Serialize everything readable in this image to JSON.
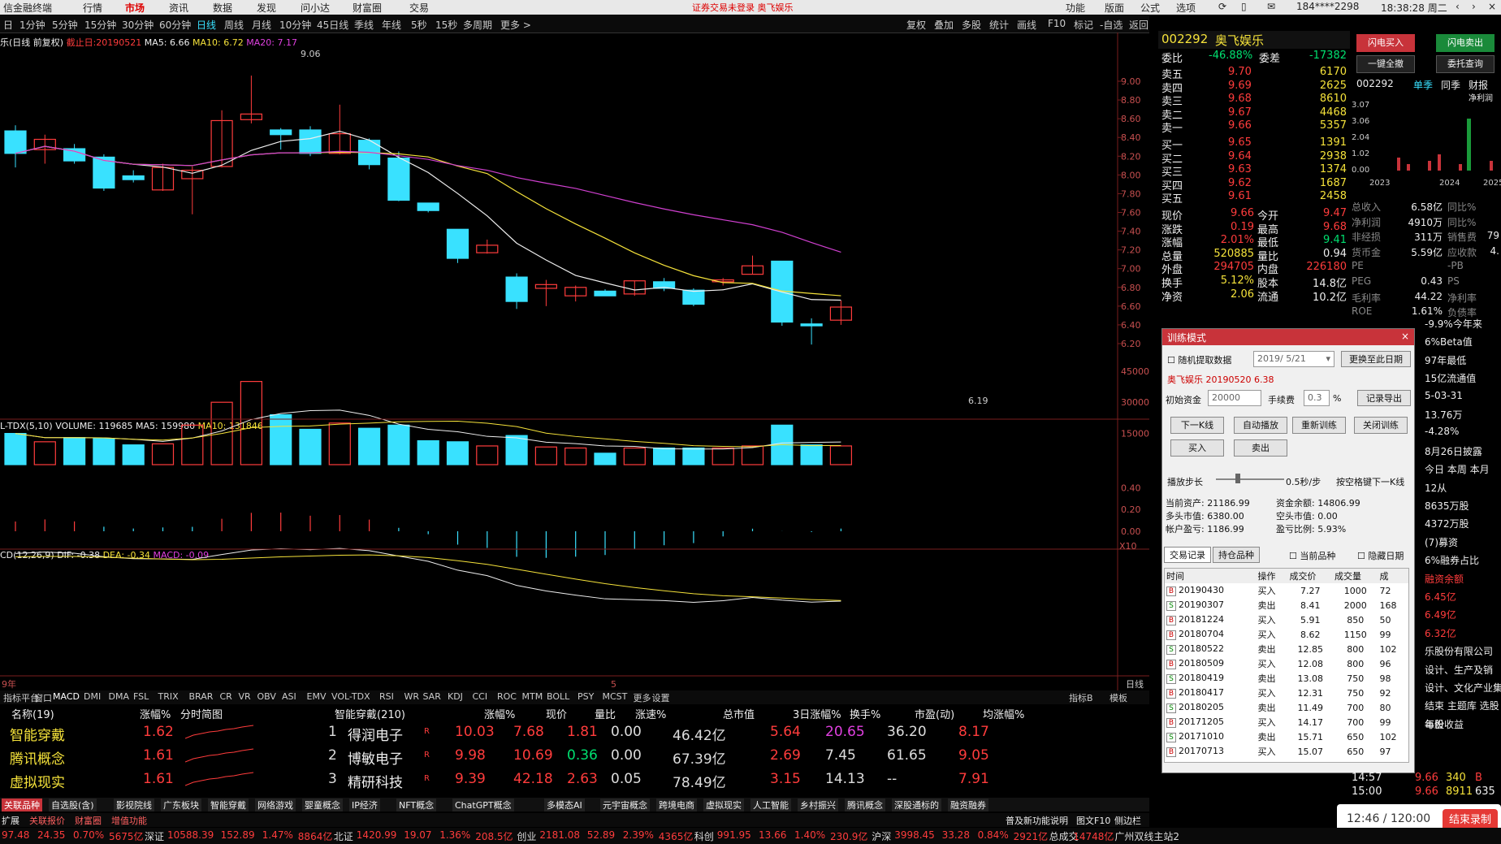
{
  "menu": {
    "items": [
      "信金融终端",
      "行情",
      "市场",
      "资讯",
      "数据",
      "发现",
      "问小达",
      "财富圈",
      "交易"
    ],
    "warning": "证券交易未登录  奥飞娱乐",
    "right": [
      "功能",
      "版面",
      "公式",
      "选项"
    ],
    "user": "184****2298",
    "time": "18:38:28 周二"
  },
  "periods": [
    "日",
    "1分钟",
    "5分钟",
    "15分钟",
    "30分钟",
    "60分钟",
    "日线",
    "周线",
    "月线",
    "10分钟",
    "45日线",
    "季线",
    "年线",
    "5秒",
    "15秒",
    "多周期",
    "更多 >"
  ],
  "toolbar_right": [
    "复权",
    "叠加",
    "多股",
    "统计",
    "画线",
    "F10",
    "标记",
    "-自选",
    "返回"
  ],
  "chart_info": {
    "title": "乐(日线 前复权)",
    "stop": "截止日:20190521",
    "ma5": "MA5: 6.66",
    "ma10": "MA10: 6.72",
    "ma20": "MA20: 7.17"
  },
  "price_axis": [
    "9.00",
    "8.80",
    "8.60",
    "8.40",
    "8.20",
    "8.00",
    "7.80",
    "7.60",
    "7.40",
    "7.20",
    "7.00",
    "6.80",
    "6.60",
    "6.40",
    "6.20"
  ],
  "price_high": "9.06",
  "price_low": "6.19",
  "vol_info": {
    "label": "L-TDX(5,10)  VOLUME: 119685",
    "ma5": "MA5: 159980",
    "ma10": "MA10: 131846"
  },
  "vol_axis": [
    "45000",
    "30000",
    "15000"
  ],
  "vol_unit": "X10",
  "macd_info": {
    "label": "CD(12,26,9)  DIF: -0.38",
    "dea": "DEA: -0.34",
    "macd": "MACD: -0.09"
  },
  "macd_axis": [
    "0.40",
    "0.20",
    "0.00"
  ],
  "x_axis": {
    "left": "9年",
    "mid": "5",
    "right": "日线"
  },
  "candles": [
    [
      8.47,
      8.23,
      8.53,
      8.08
    ],
    [
      8.27,
      8.38,
      8.43,
      8.12
    ],
    [
      8.28,
      8.15,
      8.33,
      8.12
    ],
    [
      8.19,
      7.86,
      8.22,
      7.83
    ],
    [
      7.99,
      7.95,
      8.05,
      7.92
    ],
    [
      7.84,
      8.08,
      8.12,
      7.83
    ],
    [
      7.96,
      8.05,
      8.09,
      7.58
    ],
    [
      8.09,
      8.58,
      8.69,
      8.08
    ],
    [
      8.59,
      8.65,
      9.06,
      8.55
    ],
    [
      8.48,
      8.43,
      8.5,
      8.27
    ],
    [
      8.48,
      8.23,
      8.52,
      8.2
    ],
    [
      8.23,
      8.44,
      8.75,
      8.22
    ],
    [
      8.37,
      8.11,
      8.39,
      8.06
    ],
    [
      8.18,
      7.73,
      8.25,
      7.72
    ],
    [
      7.7,
      7.62,
      7.7,
      7.6
    ],
    [
      7.42,
      7.11,
      7.42,
      7.06
    ],
    [
      7.17,
      7.25,
      7.31,
      7.16
    ],
    [
      6.91,
      6.65,
      6.95,
      6.57
    ],
    [
      6.79,
      6.83,
      6.88,
      6.6
    ],
    [
      6.71,
      6.8,
      6.82,
      6.65
    ],
    [
      6.76,
      6.71,
      6.78,
      6.71
    ],
    [
      6.73,
      6.87,
      6.87,
      6.71
    ],
    [
      6.86,
      6.79,
      6.9,
      6.76
    ],
    [
      6.77,
      6.62,
      6.79,
      6.6
    ],
    [
      6.86,
      6.88,
      6.9,
      6.82
    ],
    [
      6.94,
      7.03,
      7.14,
      6.94
    ],
    [
      7.08,
      6.43,
      7.08,
      6.39
    ],
    [
      6.41,
      6.39,
      6.47,
      6.19
    ],
    [
      6.45,
      6.59,
      6.66,
      6.4
    ]
  ],
  "volumes": [
    15000,
    11000,
    13000,
    12500,
    9500,
    10000,
    19000,
    30000,
    40000,
    24000,
    17000,
    20000,
    17500,
    19000,
    11500,
    11000,
    9000,
    14000,
    8500,
    8000,
    5500,
    8000,
    8000,
    8000,
    8000,
    9000,
    19000,
    9500,
    9000
  ],
  "orderbook": {
    "code": "002292",
    "name": "奥飞娱乐",
    "weibi": "-46.88%",
    "weicha": "-17382",
    "asks": [
      [
        "卖五",
        "9.70",
        "6170"
      ],
      [
        "卖四",
        "9.69",
        "2625"
      ],
      [
        "卖三",
        "9.68",
        "8610"
      ],
      [
        "卖二",
        "9.67",
        "4468"
      ],
      [
        "卖一",
        "9.66",
        "5357"
      ]
    ],
    "bids": [
      [
        "买一",
        "9.65",
        "1391"
      ],
      [
        "买二",
        "9.64",
        "2938"
      ],
      [
        "买三",
        "9.63",
        "1374"
      ],
      [
        "买四",
        "9.62",
        "1687"
      ],
      [
        "买五",
        "9.61",
        "2458"
      ]
    ],
    "stats": [
      [
        "现价",
        "9.66",
        "今开",
        "9.47"
      ],
      [
        "涨跌",
        "0.19",
        "最高",
        "9.68"
      ],
      [
        "涨幅",
        "2.01%",
        "最低",
        "9.41"
      ],
      [
        "总量",
        "520885",
        "量比",
        "0.94"
      ],
      [
        "外盘",
        "294705",
        "内盘",
        "226180"
      ],
      [
        "换手",
        "5.12%",
        "股本",
        "14.8亿"
      ],
      [
        "净资",
        "2.06",
        "流通",
        "10.2亿"
      ]
    ]
  },
  "right_panel": {
    "btn1": "闪电买入",
    "btn2": "闪电卖出",
    "btn3": "一键全撤",
    "btn4": "委托查询",
    "tabs": [
      "002292",
      "单季",
      "同季",
      "财报"
    ],
    "netlabel": "净利润",
    "years": [
      "2023",
      "2024",
      "2025"
    ],
    "yvals": [
      "3.07",
      "3.06",
      "2.04",
      "1.02",
      "0.00"
    ],
    "fin": [
      [
        "总收入",
        "6.58亿",
        "同比%"
      ],
      [
        "净利润",
        "4910万",
        "同比%"
      ],
      [
        "非经损",
        "311万",
        "销售费",
        "79"
      ],
      [
        "货币金",
        "5.59亿",
        "应收款",
        "4."
      ],
      [
        "PE",
        "",
        "-PB",
        ""
      ],
      [
        "PEG",
        "0.43",
        "PS",
        ""
      ],
      [
        "毛利率",
        "44.22",
        "净利率",
        ""
      ],
      [
        "ROE",
        "1.61%",
        "负债率",
        ""
      ]
    ],
    "extra": [
      "-9.9%今年来",
      "6%Beta值",
      "97年最低",
      "15亿流通值",
      "5-03-31",
      "13.76万",
      "-4.28%",
      "8月26日披露",
      "今日 本周 本月",
      "12从",
      "8635万股",
      "4372万股",
      "(7)募资",
      "6%融券占比",
      "融资余额",
      "6.45亿",
      "6.49亿",
      "6.32亿",
      "乐股份有限公司",
      "设计、生产及销",
      "设计、文化产业集团",
      "结束 主题库 选股",
      "年份",
      "每股收益"
    ]
  },
  "trainer": {
    "title": "训练模式",
    "random": "随机提取数据",
    "date": "2019/ 5/21",
    "change_date": "更换至此日期",
    "stock": "奥飞娱乐 20190520 6.38",
    "init_cap_label": "初始资金",
    "init_cap": "20000",
    "fee_label": "手续费",
    "fee": "0.3",
    "pct": "%",
    "export": "记录导出",
    "next": "下一K线",
    "auto": "自动播放",
    "retrain": "重新训练",
    "close": "关闭训练",
    "buy": "买入",
    "sell": "卖出",
    "step_label": "播放步长",
    "step": "0.5秒/步",
    "hint": "按空格键下一K线",
    "assets": "当前资产: 21186.99",
    "cash": "资金余额: 14806.99",
    "long": "多头市值: 6380.00",
    "short": "空头市值: 0.00",
    "profit": "帐户盈亏: 1186.99",
    "ratio": "盈亏比例: 5.93%",
    "tab1": "交易记录",
    "tab2": "持仓品种",
    "cur": "当前品种",
    "hide": "隐藏日期",
    "cols": [
      "时间",
      "操作",
      "成交价",
      "成交量",
      "成"
    ],
    "trades": [
      [
        "B",
        "20190430",
        "买入",
        "7.27",
        "1000",
        "72"
      ],
      [
        "S",
        "20190307",
        "卖出",
        "8.41",
        "2000",
        "168"
      ],
      [
        "B",
        "20181224",
        "买入",
        "5.91",
        "850",
        "50"
      ],
      [
        "B",
        "20180704",
        "买入",
        "8.62",
        "1150",
        "99"
      ],
      [
        "S",
        "20180522",
        "卖出",
        "12.85",
        "800",
        "102"
      ],
      [
        "B",
        "20180509",
        "买入",
        "12.08",
        "800",
        "96"
      ],
      [
        "S",
        "20180419",
        "卖出",
        "13.08",
        "750",
        "98"
      ],
      [
        "B",
        "20180417",
        "买入",
        "12.31",
        "750",
        "92"
      ],
      [
        "S",
        "20180205",
        "卖出",
        "11.49",
        "700",
        "80"
      ],
      [
        "B",
        "20171205",
        "买入",
        "14.17",
        "700",
        "99"
      ],
      [
        "S",
        "20171010",
        "卖出",
        "15.71",
        "650",
        "102"
      ],
      [
        "B",
        "20170713",
        "买入",
        "15.07",
        "650",
        "97"
      ]
    ]
  },
  "indicators": [
    "指标平台",
    "窗口",
    "MACD",
    "DMI",
    "DMA",
    "FSL",
    "TRIX",
    "BRAR",
    "CR",
    "VR",
    "OBV",
    "ASI",
    "EMV",
    "VOL-TDX",
    "RSI",
    "WR",
    "SAR",
    "KDJ",
    "CCI",
    "ROC",
    "MTM",
    "BOLL",
    "PSY",
    "MCST",
    "更多",
    "设置"
  ],
  "indicators_right": [
    "指标B",
    "模板"
  ],
  "left_table": {
    "header": [
      "名称(19)",
      "涨幅%",
      "分时简图"
    ],
    "rows": [
      [
        "智能穿戴",
        "1.62"
      ],
      [
        "腾讯概念",
        "1.61"
      ],
      [
        "虚拟现实",
        "1.61"
      ]
    ]
  },
  "main_table": {
    "header": [
      "智能穿戴(210)",
      "涨幅%",
      "现价",
      "量比",
      "涨速%",
      "总市值",
      "3日涨幅%",
      "换手%",
      "市盈(动)",
      "均涨幅%"
    ],
    "rows": [
      [
        "1",
        "得润电子",
        "10.03",
        "7.68",
        "1.81",
        "0.00",
        "46.42亿",
        "5.64",
        "20.65",
        "36.20",
        "8.17"
      ],
      [
        "2",
        "博敏电子",
        "9.98",
        "10.69",
        "0.36",
        "0.00",
        "67.39亿",
        "2.69",
        "7.45",
        "61.65",
        "9.05"
      ],
      [
        "3",
        "精研科技",
        "9.39",
        "42.18",
        "2.63",
        "0.05",
        "78.49亿",
        "3.15",
        "14.13",
        "--",
        "7.91"
      ]
    ]
  },
  "tags": [
    "关联品种",
    "自选股(含)",
    "影视院线",
    "广东板块",
    "智能穿戴",
    "网络游戏",
    "婴童概念",
    "IP经济",
    "NFT概念",
    "ChatGPT概念",
    "多模态AI",
    "元宇宙概念",
    "跨境电商",
    "虚拟现实",
    "人工智能",
    "乡村振兴",
    "腾讯概念",
    "深股通标的",
    "融资融券"
  ],
  "subtags": [
    "扩展",
    "关联报价",
    "财富圈",
    "增值功能"
  ],
  "ticker": {
    "tag1": "14:57",
    "tag2": "15:00",
    "p1": "9.66",
    "p2": "9.66",
    "v1": "340",
    "v2": "8911",
    "n1": "B",
    "n2": "635"
  },
  "status": [
    "97.48",
    "24.35",
    "0.70%",
    "5675亿",
    "深证",
    "10588.39",
    "152.89",
    "1.47%",
    "8864亿",
    "北证",
    "1420.99",
    "19.07",
    "1.36%",
    "208.5亿",
    "创业",
    "2181.08",
    "52.89",
    "2.39%",
    "4365亿",
    "科创",
    "991.95",
    "13.66",
    "1.40%",
    "230.9亿",
    "沪深",
    "3998.45",
    "33.28",
    "0.84%",
    "2921亿",
    "总成交",
    "14748亿",
    "广州双线主站2"
  ],
  "status_right": {
    "hint": "普及新功能说明",
    "f10": "图文F10",
    "other": "侧边栏"
  },
  "timer": {
    "value": "12:46 / 120:00",
    "end": "结束录制"
  }
}
